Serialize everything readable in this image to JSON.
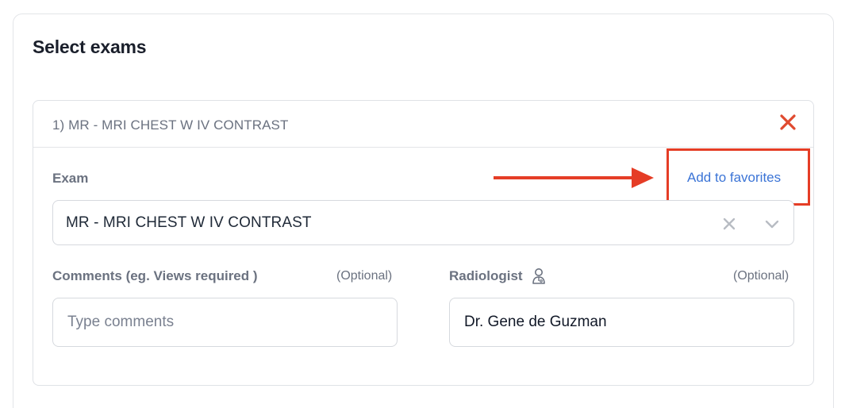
{
  "section": {
    "title": "Select exams"
  },
  "exam_card": {
    "title": "1) MR - MRI CHEST W IV CONTRAST",
    "remove_icon": "close-icon",
    "remove_color": "#e04a2f"
  },
  "exam_field": {
    "label": "Exam",
    "favorites_link": "Add to favorites",
    "selected_value": "MR - MRI CHEST W IV CONTRAST",
    "clear_icon": "clear-icon",
    "dropdown_icon": "chevron-down-icon"
  },
  "comments_field": {
    "label": "Comments (eg. Views required )",
    "optional": "(Optional)",
    "placeholder": "Type comments",
    "value": ""
  },
  "radiologist_field": {
    "label": "Radiologist",
    "icon": "doctor-icon",
    "optional": "(Optional)",
    "value": "Dr. Gene de Guzman"
  },
  "annotation": {
    "color": "#e53d26",
    "arrow_icon": "arrow-right-icon"
  },
  "colors": {
    "link": "#3b74d6",
    "label": "#6b7280",
    "border": "#d6d9de"
  }
}
